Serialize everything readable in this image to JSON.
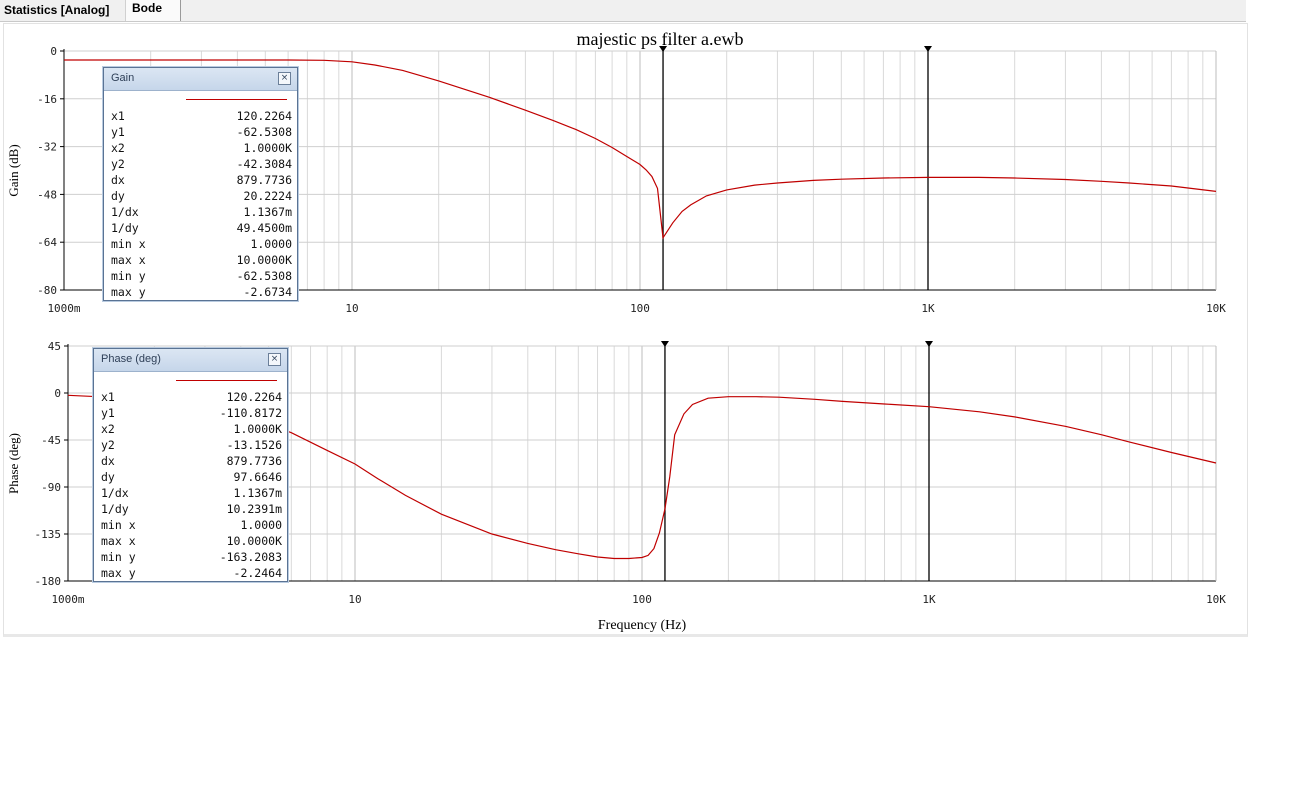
{
  "tabs": [
    {
      "label": "Statistics [Analog]"
    },
    {
      "label": "Bode"
    }
  ],
  "chart_data": [
    {
      "type": "line",
      "title": "majestic ps filter a.ewb",
      "xlabel": "",
      "ylabel": "Gain (dB)",
      "xscale": "log",
      "xlim": [
        1,
        10000
      ],
      "ylim": [
        -80,
        0
      ],
      "xticks": [
        1,
        10,
        100,
        1000,
        10000
      ],
      "xtick_labels": [
        "1000m",
        "10",
        "100",
        "1K",
        "10K"
      ],
      "yticks": [
        0,
        -16,
        -32,
        -48,
        -64,
        -80
      ],
      "ytick_labels": [
        "0",
        "-16",
        "-32",
        "-48",
        "-64",
        "-80"
      ],
      "grid": true,
      "line_color": "#c00000",
      "cursors": [
        120.2264,
        1000
      ],
      "series": [
        {
          "x": [
            1,
            2,
            4,
            6,
            8,
            10,
            12,
            15,
            20,
            30,
            40,
            50,
            60,
            70,
            80,
            90,
            100,
            105,
            110,
            115,
            120.2264,
            130,
            140,
            150,
            170,
            200,
            250,
            300,
            400,
            500,
            700,
            1000,
            1500,
            2000,
            3000,
            4000,
            5000,
            7000,
            10000
          ],
          "y": [
            -3.0,
            -3.0,
            -3.0,
            -3.0,
            -3.1,
            -3.6,
            -4.7,
            -6.5,
            -10.0,
            -15.5,
            -19.8,
            -23.3,
            -26.3,
            -29.3,
            -32.3,
            -35.3,
            -38.0,
            -39.8,
            -42.0,
            -46.0,
            -62.5308,
            -57.5,
            -53.7,
            -51.5,
            -48.5,
            -46.5,
            -44.9,
            -44.2,
            -43.3,
            -42.9,
            -42.5,
            -42.3084,
            -42.3,
            -42.5,
            -43.0,
            -43.6,
            -44.2,
            -45.2,
            -47.0
          ]
        }
      ],
      "legend": {
        "title": "Gain",
        "rows": [
          {
            "k": "x1",
            "v": "120.2264"
          },
          {
            "k": "y1",
            "v": "-62.5308"
          },
          {
            "k": "x2",
            "v": "1.0000K"
          },
          {
            "k": "y2",
            "v": "-42.3084"
          },
          {
            "k": "dx",
            "v": "879.7736"
          },
          {
            "k": "dy",
            "v": "20.2224"
          },
          {
            "k": "1/dx",
            "v": "1.1367m"
          },
          {
            "k": "1/dy",
            "v": "49.4500m"
          },
          {
            "k": "min x",
            "v": "1.0000"
          },
          {
            "k": "max x",
            "v": "10.0000K"
          },
          {
            "k": "min y",
            "v": "-62.5308"
          },
          {
            "k": "max y",
            "v": "-2.6734"
          }
        ]
      }
    },
    {
      "type": "line",
      "title": "",
      "xlabel": "Frequency (Hz)",
      "ylabel": "Phase (deg)",
      "xscale": "log",
      "xlim": [
        1,
        10000
      ],
      "ylim": [
        -180,
        45
      ],
      "xticks": [
        1,
        10,
        100,
        1000,
        10000
      ],
      "xtick_labels": [
        "1000m",
        "10",
        "100",
        "1K",
        "10K"
      ],
      "yticks": [
        45,
        0,
        -45,
        -90,
        -135,
        -180
      ],
      "ytick_labels": [
        "45",
        "0",
        "-45",
        "-90",
        "-135",
        "-180"
      ],
      "grid": true,
      "line_color": "#c00000",
      "cursors": [
        120.2264,
        1000
      ],
      "series": [
        {
          "x": [
            1,
            2,
            4,
            6,
            8,
            10,
            12,
            15,
            20,
            30,
            40,
            50,
            60,
            70,
            80,
            90,
            100,
            105,
            110,
            115,
            120.2264,
            125,
            130,
            140,
            150,
            170,
            200,
            250,
            300,
            400,
            500,
            700,
            1000,
            1500,
            2000,
            3000,
            4000,
            5000,
            7000,
            10000
          ],
          "y": [
            -2.2,
            -6,
            -20,
            -38,
            -55,
            -68,
            -82,
            -98,
            -116,
            -135,
            -144,
            -150,
            -154,
            -157,
            -158.5,
            -158.5,
            -157.5,
            -155.5,
            -149,
            -134,
            -110.8172,
            -80,
            -40,
            -20,
            -11,
            -5,
            -3.5,
            -3.5,
            -4,
            -6,
            -8,
            -10.5,
            -13.1526,
            -18,
            -23,
            -32,
            -40,
            -47,
            -57,
            -67
          ]
        }
      ],
      "legend": {
        "title": "Phase (deg)",
        "rows": [
          {
            "k": "x1",
            "v": "120.2264"
          },
          {
            "k": "y1",
            "v": "-110.8172"
          },
          {
            "k": "x2",
            "v": "1.0000K"
          },
          {
            "k": "y2",
            "v": "-13.1526"
          },
          {
            "k": "dx",
            "v": "879.7736"
          },
          {
            "k": "dy",
            "v": "97.6646"
          },
          {
            "k": "1/dx",
            "v": "1.1367m"
          },
          {
            "k": "1/dy",
            "v": "10.2391m"
          },
          {
            "k": "min x",
            "v": "1.0000"
          },
          {
            "k": "max x",
            "v": "10.0000K"
          },
          {
            "k": "min y",
            "v": "-163.2083"
          },
          {
            "k": "max y",
            "v": "-2.2464"
          }
        ]
      }
    }
  ]
}
